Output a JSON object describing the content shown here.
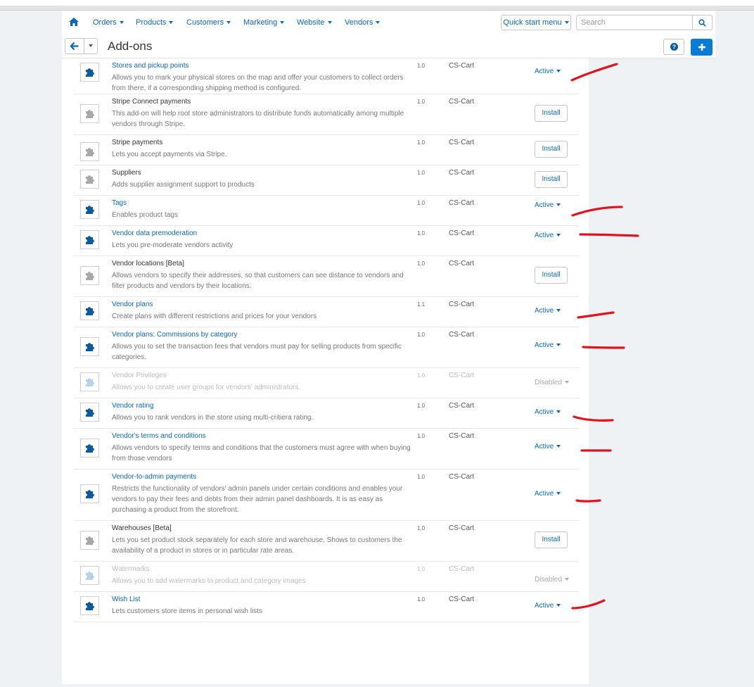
{
  "nav": {
    "items": [
      {
        "label": "Orders"
      },
      {
        "label": "Products"
      },
      {
        "label": "Customers"
      },
      {
        "label": "Marketing"
      },
      {
        "label": "Website"
      },
      {
        "label": "Vendors"
      }
    ],
    "quick_start": "Quick start menu",
    "search_placeholder": "Search"
  },
  "page": {
    "title": "Add-ons"
  },
  "addons": [
    {
      "name": "Stores and pickup points",
      "desc": "Allows you to mark your physical stores on the map and offer your customers to collect orders from there, if a corresponding shipping method is configured.",
      "version": "1.0",
      "provider": "CS-Cart",
      "state": "Active"
    },
    {
      "name": "Stripe Connect payments",
      "desc": "This add-on will help root store administrators to distribute funds automatically among multiple vendors through Stripe.",
      "version": "1.0",
      "provider": "CS-Cart",
      "state": "Install"
    },
    {
      "name": "Stripe payments",
      "desc": "Lets you accept payments via Stripe.",
      "version": "1.0",
      "provider": "CS-Cart",
      "state": "Install"
    },
    {
      "name": "Suppliers",
      "desc": "Adds supplier assignment support to products",
      "version": "1.0",
      "provider": "CS-Cart",
      "state": "Install"
    },
    {
      "name": "Tags",
      "desc": "Enables product tags",
      "version": "1.0",
      "provider": "CS-Cart",
      "state": "Active"
    },
    {
      "name": "Vendor data premoderation",
      "desc": "Lets you pre-moderate vendors activity",
      "version": "1.0",
      "provider": "CS-Cart",
      "state": "Active"
    },
    {
      "name": "Vendor locations [Beta]",
      "desc": "Allows vendors to specify their addresses, so that customers can see distance to vendors and filter products and vendors by their locations.",
      "version": "1.0",
      "provider": "CS-Cart",
      "state": "Install"
    },
    {
      "name": "Vendor plans",
      "desc": "Create plans with different restrictions and prices for your vendors",
      "version": "1.1",
      "provider": "CS-Cart",
      "state": "Active"
    },
    {
      "name": "Vendor plans: Commissions by category",
      "desc": "Allows you to set the transaction fees that vendors must pay for selling products from specific categories.",
      "version": "1.0",
      "provider": "CS-Cart",
      "state": "Active"
    },
    {
      "name": "Vendor Privileges",
      "desc": "Allows you to create user groups for vendors' administrators.",
      "version": "1.0",
      "provider": "CS-Cart",
      "state": "Disabled"
    },
    {
      "name": "Vendor rating",
      "desc": "Allows you to rank vendors in the store using multi-critiera rating.",
      "version": "1.0",
      "provider": "CS-Cart",
      "state": "Active"
    },
    {
      "name": "Vendor's terms and conditions",
      "desc": "Allows vendors to specify terms and conditions that the customers must agree with when buying from those vendors",
      "version": "1.0",
      "provider": "CS-Cart",
      "state": "Active"
    },
    {
      "name": "Vendor-to-admin payments",
      "desc": "Restricts the functionality of vendors' admin panels under certain conditions and enables your vendors to pay their fees and debts from their admin panel dashboards. It is as easy as purchasing a product from the storefront.",
      "version": "1.0",
      "provider": "CS-Cart",
      "state": "Active"
    },
    {
      "name": "Warehouses [Beta]",
      "desc": "Lets you set product stock separately for each store and warehouse. Shows to customers the availability of a product in stores or in particular rate areas.",
      "version": "1.0",
      "provider": "CS-Cart",
      "state": "Install"
    },
    {
      "name": "Watermarks",
      "desc": "Allows you to add watermarks to product and category images",
      "version": "1.0",
      "provider": "CS-Cart",
      "state": "Disabled"
    },
    {
      "name": "Wish List",
      "desc": "Lets customers store items in personal wish lists",
      "version": "1.0",
      "provider": "CS-Cart",
      "state": "Active"
    }
  ],
  "icons": {
    "home": "home-icon",
    "back": "arrow-left-icon",
    "dropdown": "chevron-down-icon",
    "search": "search-icon",
    "help": "question-icon",
    "add": "plus-icon",
    "addon": "puzzle-icon"
  },
  "colors": {
    "link": "#0b68b3",
    "primary_button": "#0a7cd6",
    "icon_active": "#0b5a9a",
    "icon_inactive": "#a8a8a8",
    "icon_disabled": "#b9d3e6",
    "annotation": "#e0141e"
  }
}
